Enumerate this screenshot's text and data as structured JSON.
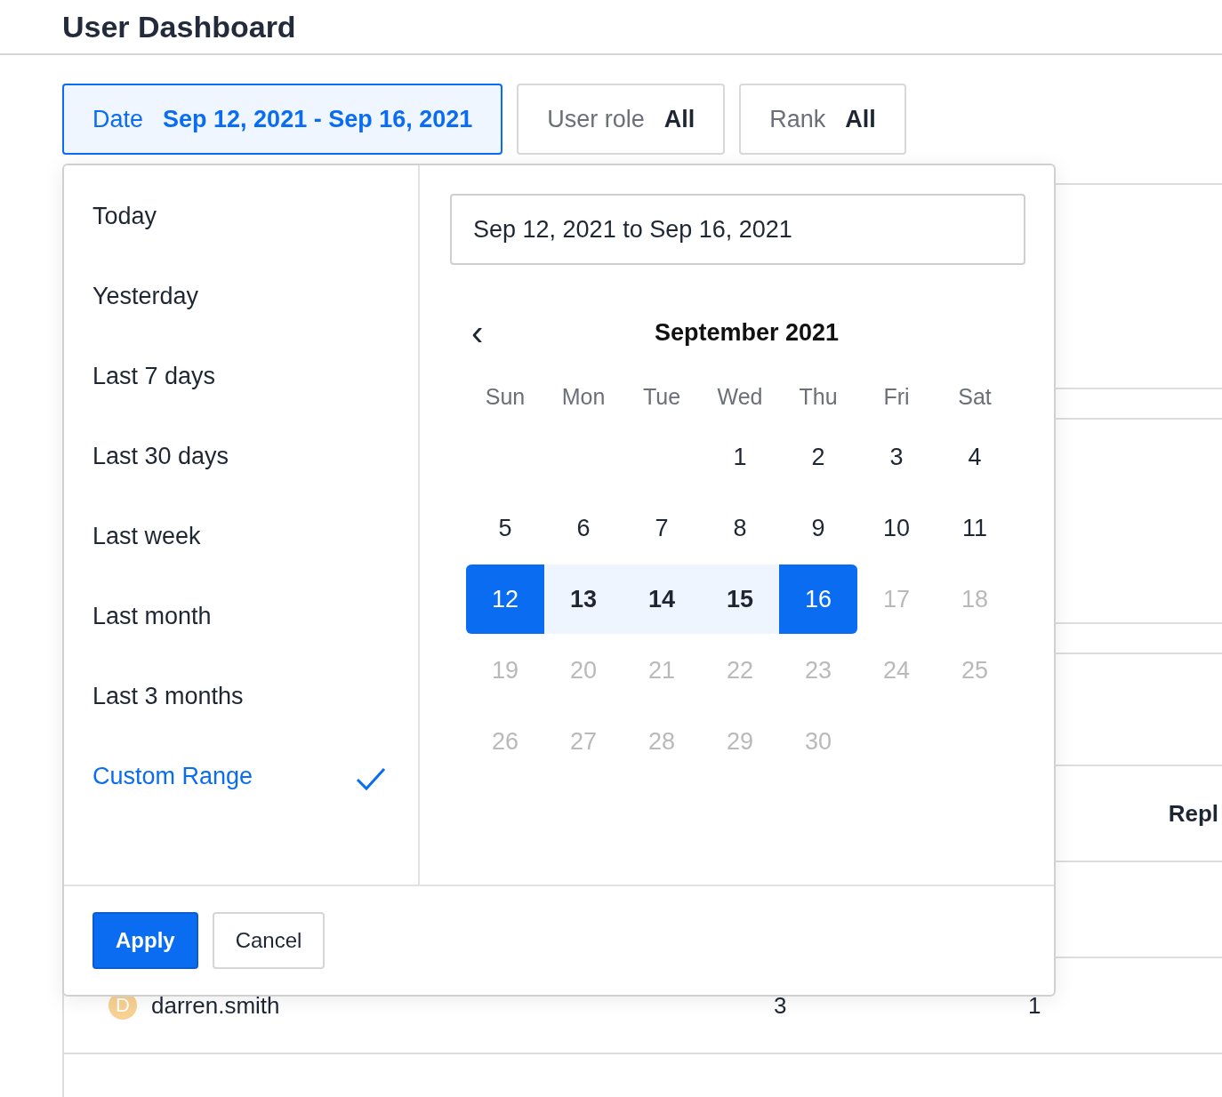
{
  "page": {
    "title": "User Dashboard"
  },
  "filters": [
    {
      "label": "Date",
      "value": "Sep 12, 2021 - Sep 16, 2021",
      "selected": true
    },
    {
      "label": "User role",
      "value": "All",
      "selected": false
    },
    {
      "label": "Rank",
      "value": "All",
      "selected": false
    }
  ],
  "table": {
    "column_header": "Repl",
    "rows": [
      {
        "avatar": "D",
        "color": "#f8d193",
        "name": "darren.smith",
        "column_2": "3",
        "column_3": "1"
      }
    ]
  },
  "date_picker": {
    "presets": [
      {
        "label": "Today",
        "selected": false
      },
      {
        "label": "Yesterday",
        "selected": false
      },
      {
        "label": "Last 7 days",
        "selected": false
      },
      {
        "label": "Last 30 days",
        "selected": false
      },
      {
        "label": "Last week",
        "selected": false
      },
      {
        "label": "Last month",
        "selected": false
      },
      {
        "label": "Last 3 months",
        "selected": false
      },
      {
        "label": "Custom Range",
        "selected": true
      }
    ],
    "range_value": "Sep 12, 2021 to Sep 16, 2021",
    "month": "September 2021",
    "prev_button": "‹",
    "weekdays": [
      "Sun",
      "Mon",
      "Tue",
      "Wed",
      "Thu",
      "Fri",
      "Sat"
    ],
    "weeks": [
      [
        {
          "day": "1",
          "selected": false,
          "in_range": false,
          "disabled": false
        },
        {
          "day": "2",
          "selected": false,
          "in_range": false,
          "disabled": false
        },
        {
          "day": "3",
          "selected": false,
          "in_range": false,
          "disabled": false
        },
        {
          "day": "4",
          "selected": false,
          "in_range": false,
          "disabled": false
        }
      ],
      [
        {
          "day": "5",
          "selected": false,
          "in_range": false,
          "disabled": false
        },
        {
          "day": "6",
          "selected": false,
          "in_range": false,
          "disabled": false
        },
        {
          "day": "7",
          "selected": false,
          "in_range": false,
          "disabled": false
        },
        {
          "day": "8",
          "selected": false,
          "in_range": false,
          "disabled": false
        },
        {
          "day": "9",
          "selected": false,
          "in_range": false,
          "disabled": false
        },
        {
          "day": "10",
          "selected": false,
          "in_range": false,
          "disabled": false
        },
        {
          "day": "11",
          "selected": false,
          "in_range": false,
          "disabled": false
        }
      ],
      [
        {
          "day": "12",
          "selected": true,
          "in_range": true,
          "disabled": false
        },
        {
          "day": "13",
          "selected": false,
          "in_range": true,
          "disabled": false
        },
        {
          "day": "14",
          "selected": false,
          "in_range": true,
          "disabled": false
        },
        {
          "day": "15",
          "selected": false,
          "in_range": true,
          "disabled": false
        },
        {
          "day": "16",
          "selected": true,
          "in_range": true,
          "disabled": false
        },
        {
          "day": "17",
          "selected": false,
          "in_range": false,
          "disabled": true
        },
        {
          "day": "18",
          "selected": false,
          "in_range": false,
          "disabled": true
        }
      ],
      [
        {
          "day": "19",
          "selected": false,
          "in_range": false,
          "disabled": true
        },
        {
          "day": "20",
          "selected": false,
          "in_range": false,
          "disabled": true
        },
        {
          "day": "21",
          "selected": false,
          "in_range": false,
          "disabled": true
        },
        {
          "day": "22",
          "selected": false,
          "in_range": false,
          "disabled": true
        },
        {
          "day": "23",
          "selected": false,
          "in_range": false,
          "disabled": true
        },
        {
          "day": "24",
          "selected": false,
          "in_range": false,
          "disabled": true
        },
        {
          "day": "25",
          "selected": false,
          "in_range": false,
          "disabled": true
        }
      ],
      [
        {
          "day": "26",
          "selected": false,
          "in_range": false,
          "disabled": true
        },
        {
          "day": "27",
          "selected": false,
          "in_range": false,
          "disabled": true
        },
        {
          "day": "28",
          "selected": false,
          "in_range": false,
          "disabled": true
        },
        {
          "day": "29",
          "selected": false,
          "in_range": false,
          "disabled": true
        },
        {
          "day": "30",
          "selected": false,
          "in_range": false,
          "disabled": true
        }
      ]
    ],
    "buttons": [
      {
        "label": "Apply",
        "kind": "primary"
      },
      {
        "label": "Cancel",
        "kind": "secondary"
      }
    ]
  }
}
